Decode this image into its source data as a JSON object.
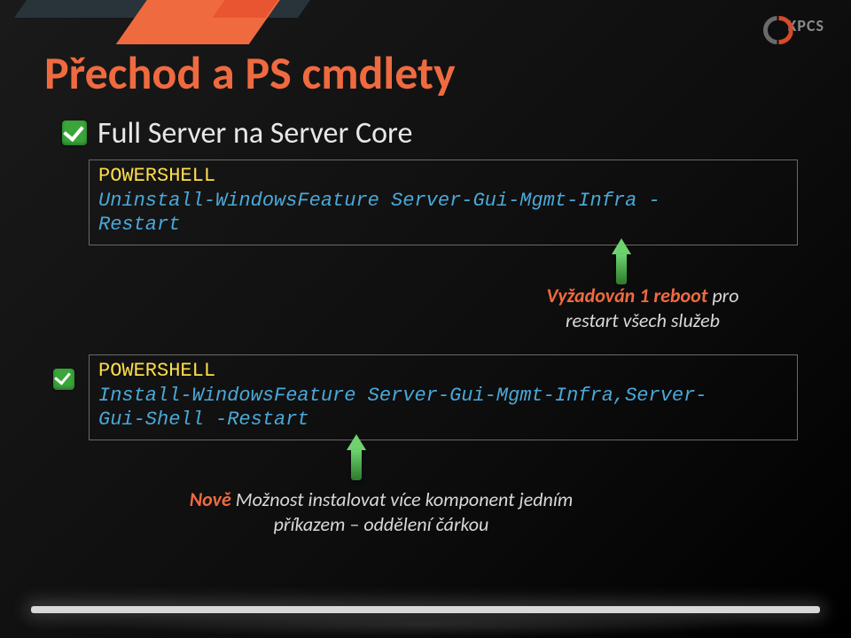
{
  "logo": {
    "text": "KPCS"
  },
  "title": "Přechod a PS cmdlety",
  "bullet1": "Full Server na Server Core",
  "code1": {
    "label": "POWERSHELL",
    "line1": "Uninstall-WindowsFeature Server-Gui-Mgmt-Infra -",
    "line2": "Restart"
  },
  "annot1": {
    "highlight": "Vyžadován 1 reboot",
    "rest": " pro restart všech služeb"
  },
  "code2": {
    "label": "POWERSHELL",
    "line1": "Install-WindowsFeature Server-Gui-Mgmt-Infra,Server-",
    "line2": "Gui-Shell -Restart"
  },
  "annot2": {
    "highlight": "Nově",
    "rest": " Možnost instalovat více komponent jedním příkazem – oddělení čárkou"
  }
}
